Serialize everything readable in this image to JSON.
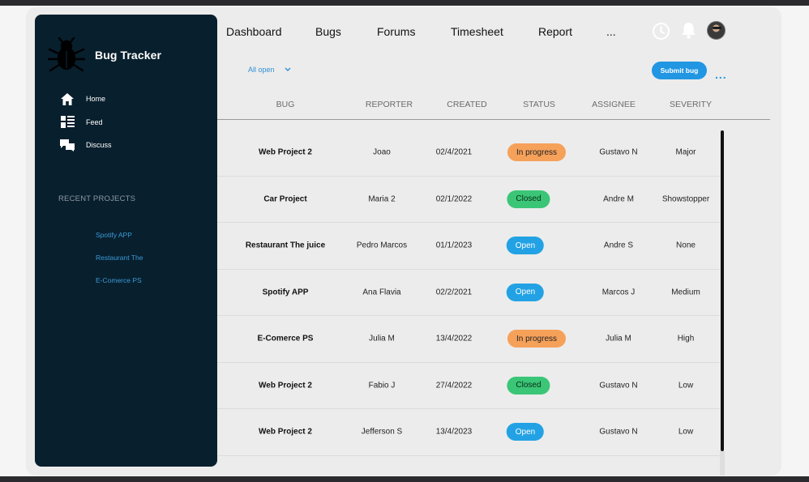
{
  "sidebar": {
    "brand_title": "Bug Tracker",
    "nav": [
      {
        "label": "Home",
        "icon": "home-icon"
      },
      {
        "label": "Feed",
        "icon": "feed-icon"
      },
      {
        "label": "Discuss",
        "icon": "discuss-icon"
      }
    ],
    "recent_title": "RECENT PROJECTS",
    "recent": [
      "Spotify APP",
      "Restaurant The",
      "E-Comerce PS"
    ]
  },
  "topnav": {
    "items": [
      "Dashboard",
      "Bugs",
      "Forums",
      "Timesheet",
      "Report",
      "..."
    ],
    "icons": [
      "clock-icon",
      "bell-icon",
      "avatar"
    ]
  },
  "filter": {
    "selected": "All open"
  },
  "actions": {
    "submit_label": "Submit bug",
    "more_label": "..."
  },
  "table": {
    "columns": [
      "BUG",
      "REPORTER",
      "CREATED",
      "STATUS",
      "ASSIGNEE",
      "SEVERITY"
    ],
    "rows": [
      {
        "bug": "Web Project 2",
        "reporter": "Joao",
        "created": "02/4/2021",
        "status": "In progress",
        "assignee": "Gustavo N",
        "severity": "Major"
      },
      {
        "bug": "Car Project",
        "reporter": "Maria 2",
        "created": "02/1/2022",
        "status": "Closed",
        "assignee": "Andre M",
        "severity": "Showstopper"
      },
      {
        "bug": "Restaurant The juice",
        "reporter": "Pedro Marcos",
        "created": "01/1/2023",
        "status": "Open",
        "assignee": "Andre S",
        "severity": "None"
      },
      {
        "bug": "Spotify APP",
        "reporter": "Ana Flavia",
        "created": "02/2/2021",
        "status": "Open",
        "assignee": "Marcos J",
        "severity": "Medium"
      },
      {
        "bug": "E-Comerce PS",
        "reporter": "Julia M",
        "created": "13/4/2022",
        "status": "In progress",
        "assignee": "Julia M",
        "severity": "High"
      },
      {
        "bug": "Web Project 2",
        "reporter": "Fabio J",
        "created": "27/4/2022",
        "status": "Closed",
        "assignee": "Gustavo N",
        "severity": "Low"
      },
      {
        "bug": "Web Project 2",
        "reporter": "Jefferson S",
        "created": "13/4/2023",
        "status": "Open",
        "assignee": "Gustavo N",
        "severity": "Low"
      }
    ]
  },
  "colors": {
    "sidebar_bg": "#081f2d",
    "accent": "#2196e3",
    "status_in_progress": "#f6a15a",
    "status_closed": "#3ac676",
    "status_open": "#22a2e4"
  }
}
